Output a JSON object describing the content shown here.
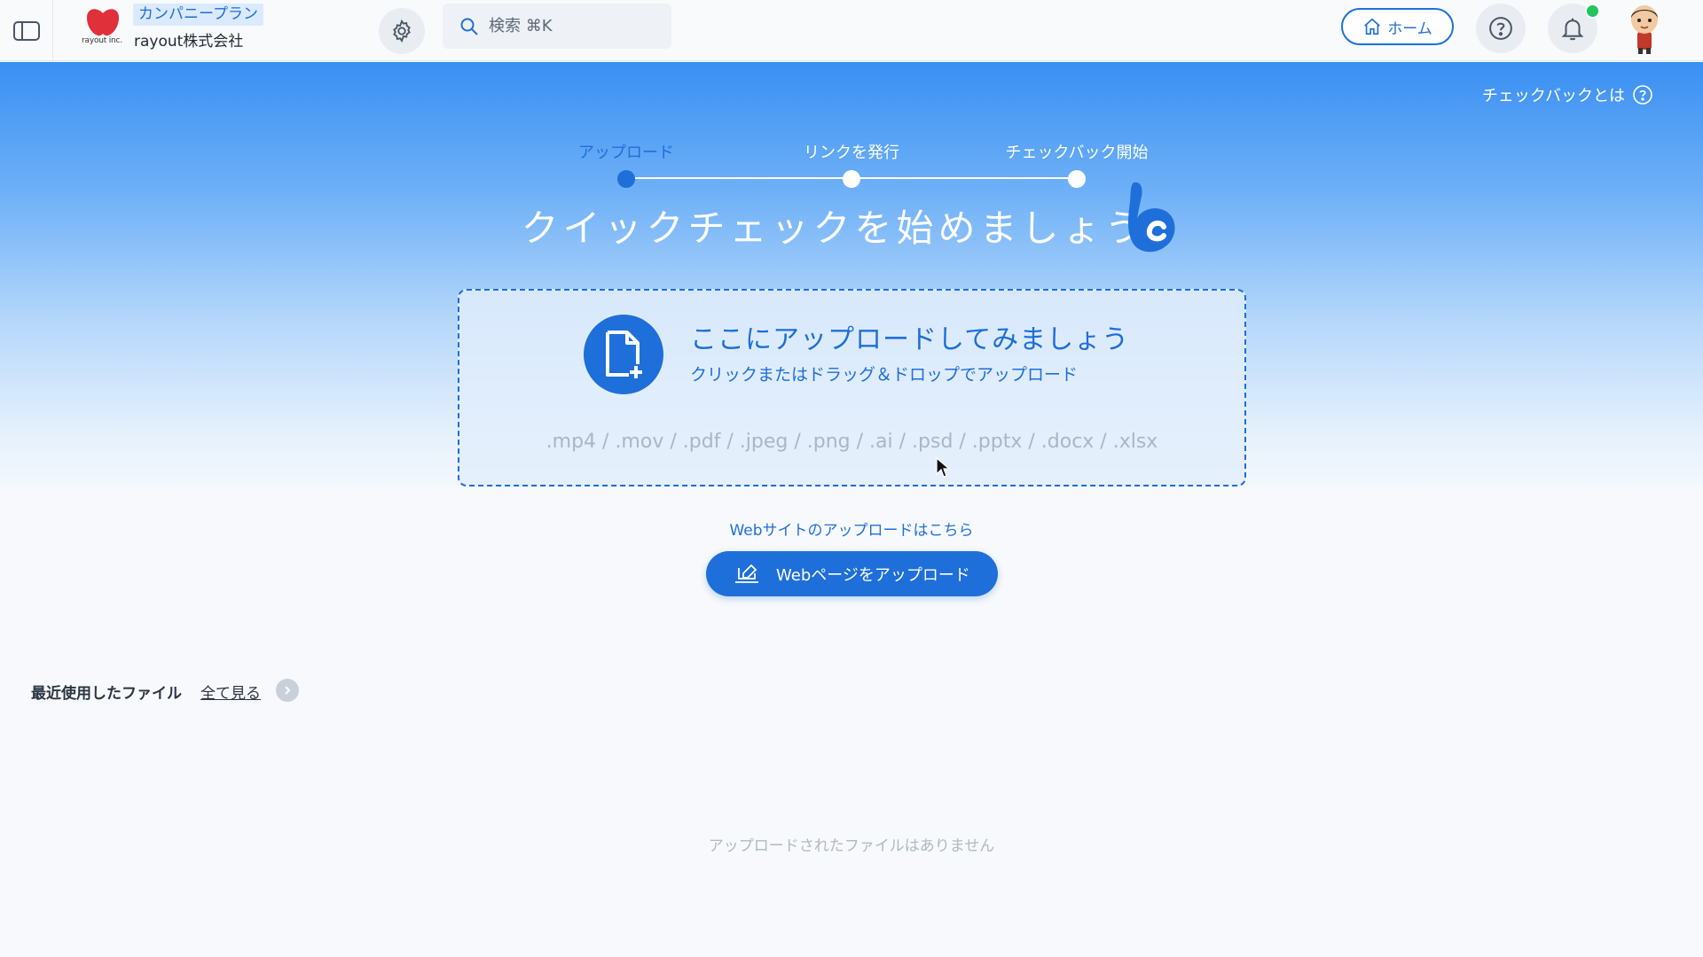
{
  "topbar": {
    "logo_text": "rayout inc.",
    "plan": "カンパニープラン",
    "company": "rayout株式会社",
    "search_placeholder": "検索 ⌘K",
    "home_label": "ホーム"
  },
  "hero": {
    "whatis_label": "チェックバックとは",
    "steps": [
      "アップロード",
      "リンクを発行",
      "チェックバック開始"
    ],
    "active_step": 0,
    "title": "クイックチェックを始めましょう",
    "dropzone": {
      "title": "ここにアップロードしてみましょう",
      "subtitle": "クリックまたはドラッグ＆ドロップでアップロード",
      "formats": ".mp4 / .mov / .pdf / .jpeg / .png / .ai / .psd / .pptx / .docx / .xlsx"
    }
  },
  "web": {
    "note": "Webサイトのアップロードはこちら",
    "button_label": "Webページをアップロード"
  },
  "recent": {
    "label": "最近使用したファイル",
    "see_all": "全て見る",
    "empty": "アップロードされたファイルはありません"
  },
  "colors": {
    "accent": "#1e6fd9",
    "notification": "#22c55e",
    "logo_red": "#e0303a"
  }
}
